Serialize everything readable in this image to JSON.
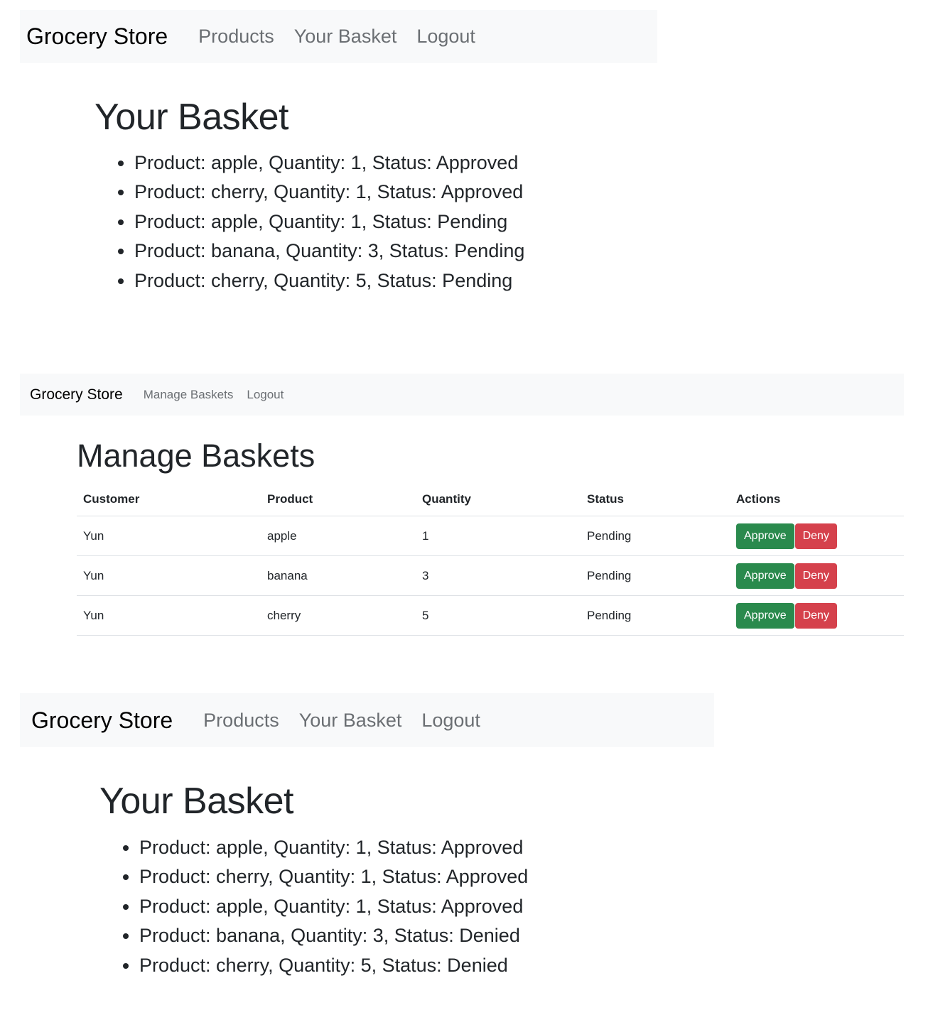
{
  "panel1": {
    "navbar": {
      "brand": "Grocery Store",
      "links": [
        "Products",
        "Your Basket",
        "Logout"
      ]
    },
    "title": "Your Basket",
    "items": [
      "Product: apple, Quantity: 1, Status: Approved",
      "Product: cherry, Quantity: 1, Status: Approved",
      "Product: apple, Quantity: 1, Status: Pending",
      "Product: banana, Quantity: 3, Status: Pending",
      "Product: cherry, Quantity: 5, Status: Pending"
    ]
  },
  "panel2": {
    "navbar": {
      "brand": "Grocery Store",
      "links": [
        "Manage Baskets",
        "Logout"
      ]
    },
    "title": "Manage Baskets",
    "table": {
      "headers": [
        "Customer",
        "Product",
        "Quantity",
        "Status",
        "Actions"
      ],
      "rows": [
        {
          "customer": "Yun",
          "product": "apple",
          "quantity": "1",
          "status": "Pending"
        },
        {
          "customer": "Yun",
          "product": "banana",
          "quantity": "3",
          "status": "Pending"
        },
        {
          "customer": "Yun",
          "product": "cherry",
          "quantity": "5",
          "status": "Pending"
        }
      ],
      "approve_label": "Approve",
      "deny_label": "Deny"
    }
  },
  "panel3": {
    "navbar": {
      "brand": "Grocery Store",
      "links": [
        "Products",
        "Your Basket",
        "Logout"
      ]
    },
    "title": "Your Basket",
    "items": [
      "Product: apple, Quantity: 1, Status: Approved",
      "Product: cherry, Quantity: 1, Status: Approved",
      "Product: apple, Quantity: 1, Status: Approved",
      "Product: banana, Quantity: 3, Status: Denied",
      "Product: cherry, Quantity: 5, Status: Denied"
    ]
  },
  "colors": {
    "navbar_bg": "#f8f9fa",
    "approve": "#2a8a4d",
    "deny": "#d5414c",
    "text": "#212529",
    "nav_link": "#6b6f73"
  }
}
